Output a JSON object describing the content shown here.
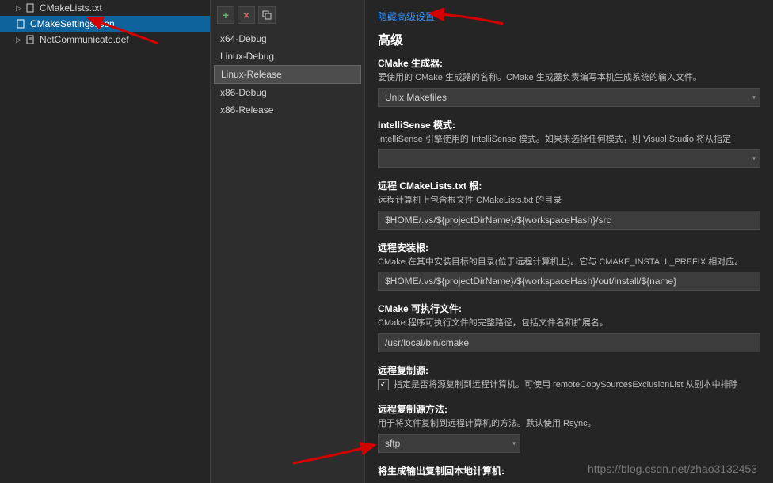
{
  "sidebar": {
    "items": [
      {
        "label": "CMakeLists.txt",
        "selected": false
      },
      {
        "label": "CMakeSettings.json",
        "selected": true
      },
      {
        "label": "NetCommunicate.def",
        "selected": false
      }
    ]
  },
  "configs": {
    "items": [
      {
        "label": "x64-Debug",
        "selected": false
      },
      {
        "label": "Linux-Debug",
        "selected": false
      },
      {
        "label": "Linux-Release",
        "selected": true
      },
      {
        "label": "x86-Debug",
        "selected": false
      },
      {
        "label": "x86-Release",
        "selected": false
      }
    ]
  },
  "main": {
    "hide_link": "隐藏高级设置",
    "section_title": "高级",
    "generator": {
      "label": "CMake 生成器:",
      "desc": "要使用的 CMake 生成器的名称。CMake 生成器负责编写本机生成系统的输入文件。",
      "value": "Unix Makefiles"
    },
    "intellisense": {
      "label": "IntelliSense 模式:",
      "desc": "IntelliSense 引擎使用的 IntelliSense 模式。如果未选择任何模式，则 Visual Studio 将从指定",
      "value": ""
    },
    "remote_root": {
      "label": "远程 CMakeLists.txt 根:",
      "desc": "远程计算机上包含根文件 CMakeLists.txt 的目录",
      "value": "$HOME/.vs/${projectDirName}/${workspaceHash}/src"
    },
    "install_root": {
      "label": "远程安装根:",
      "desc": "CMake 在其中安装目标的目录(位于远程计算机上)。它与 CMAKE_INSTALL_PREFIX 相对应。",
      "value": "$HOME/.vs/${projectDirName}/${workspaceHash}/out/install/${name}"
    },
    "cmake_exe": {
      "label": "CMake 可执行文件:",
      "desc": "CMake 程序可执行文件的完整路径，包括文件名和扩展名。",
      "value": "/usr/local/bin/cmake"
    },
    "remote_copy": {
      "label": "远程复制源:",
      "checkbox_label": "指定是否将源复制到远程计算机。可使用 remoteCopySourcesExclusionList 从副本中排除"
    },
    "copy_method": {
      "label": "远程复制源方法:",
      "desc": "用于将文件复制到远程计算机的方法。默认使用 Rsync。",
      "value": "sftp"
    },
    "copy_output": {
      "label": "将生成输出复制回本地计算机:"
    }
  },
  "watermark": "https://blog.csdn.net/zhao3132453"
}
